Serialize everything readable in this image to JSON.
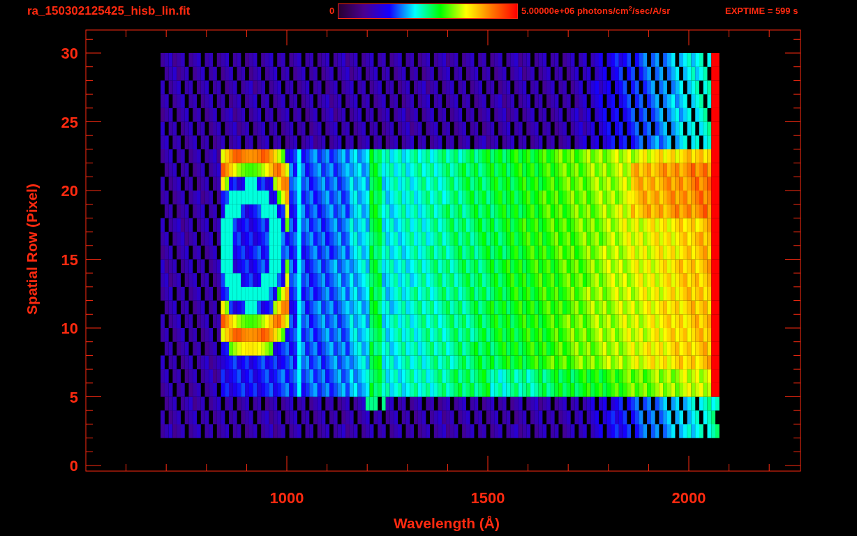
{
  "header": {
    "file_name": "ra_150302125425_hisb_lin.fit",
    "colorbar": {
      "min_label": "0",
      "max_label": "5.00000e+06 photons/cm$^{2}$/sec/A/sr"
    },
    "exposure": "EXPTIME = 599 s"
  },
  "plot": {
    "y_axis": {
      "title": "Spatial Row (Pixel)",
      "ticks": [
        "30",
        "25",
        "20",
        "15",
        "10",
        "5",
        "0"
      ]
    },
    "x_axis": {
      "title": "Wavelength (Å)",
      "ticks": [
        "1000",
        "1500",
        "2000"
      ]
    }
  }
}
